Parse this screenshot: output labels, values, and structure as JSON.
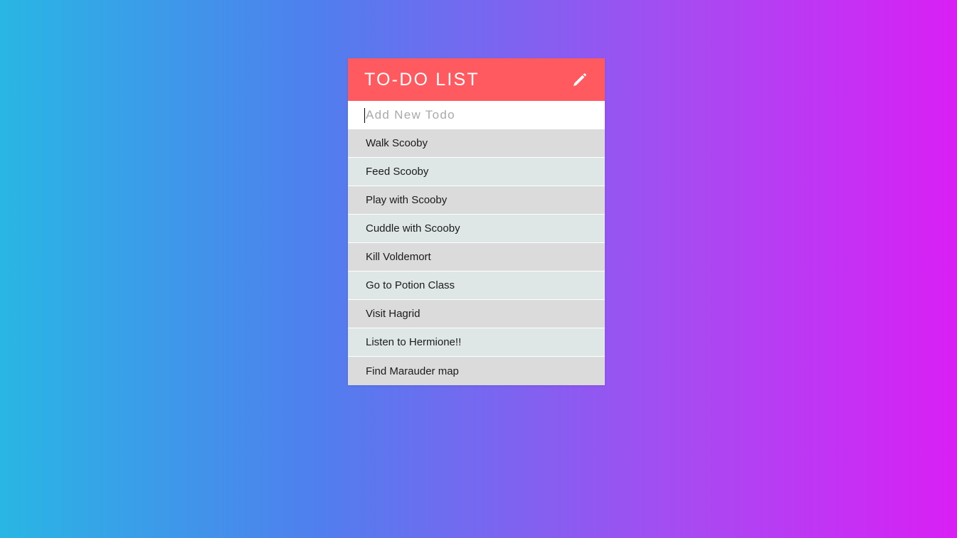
{
  "background": {
    "gradient_from": "#29b6e4",
    "gradient_to": "#d91ff5",
    "direction": "left-to-right"
  },
  "card": {
    "accent_color": "#ff5a5f",
    "row_color_odd": "#dbdbdb",
    "row_color_even": "#dfe7e6"
  },
  "header": {
    "title": "TO-DO LIST",
    "edit_icon": "pencil-icon"
  },
  "input": {
    "placeholder": "Add New Todo",
    "value": ""
  },
  "todos": [
    {
      "label": "Walk Scooby"
    },
    {
      "label": "Feed Scooby"
    },
    {
      "label": "Play with Scooby"
    },
    {
      "label": "Cuddle with Scooby"
    },
    {
      "label": "Kill Voldemort"
    },
    {
      "label": "Go to Potion Class"
    },
    {
      "label": "Visit Hagrid"
    },
    {
      "label": "Listen to Hermione!!"
    },
    {
      "label": "Find Marauder map"
    }
  ]
}
